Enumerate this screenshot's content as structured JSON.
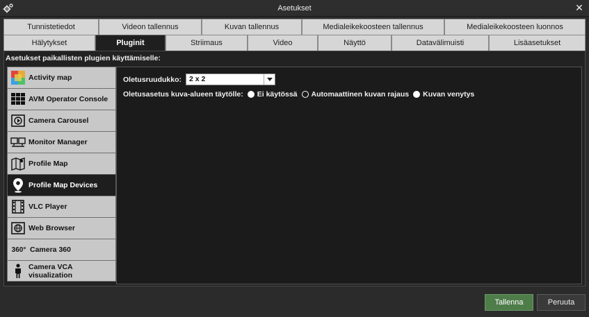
{
  "window": {
    "title": "Asetukset"
  },
  "tabs": {
    "row1": [
      {
        "label": "Tunnistetiedot"
      },
      {
        "label": "Videon tallennus"
      },
      {
        "label": "Kuvan tallennus"
      },
      {
        "label": "Medialeikekoosteen tallennus"
      },
      {
        "label": "Medialeikekoosteen luonnos"
      }
    ],
    "row2": [
      {
        "label": "Hälytykset"
      },
      {
        "label": "Pluginit",
        "active": true
      },
      {
        "label": "Striimaus"
      },
      {
        "label": "Video"
      },
      {
        "label": "Näyttö"
      },
      {
        "label": "Datavälimuisti"
      },
      {
        "label": "Lisäasetukset"
      }
    ]
  },
  "panel": {
    "caption": "Asetukset paikallisten plugien käyttämiselle:"
  },
  "plugins": [
    {
      "label": "Activity map",
      "icon": "activity-map-icon"
    },
    {
      "label": "AVM Operator Console",
      "icon": "video-wall-icon"
    },
    {
      "label": "Camera Carousel",
      "icon": "camera-carousel-icon"
    },
    {
      "label": "Monitor Manager",
      "icon": "monitor-icon"
    },
    {
      "label": "Profile Map",
      "icon": "map-icon"
    },
    {
      "label": "Profile Map Devices",
      "icon": "map-pin-icon",
      "active": true
    },
    {
      "label": "VLC Player",
      "icon": "film-icon"
    },
    {
      "label": "Web Browser",
      "icon": "globe-icon"
    },
    {
      "label": "Camera 360",
      "icon": "camera-360-icon",
      "icon_text": "360°"
    },
    {
      "label": "Camera VCA visualization",
      "icon": "person-icon"
    }
  ],
  "settings": {
    "grid_label": "Oletusruudukko:",
    "grid_value": "2 x 2",
    "fill_label": "Oletusasetus kuva-alueen täytölle:",
    "fill_options": [
      {
        "label": "Ei käytössä",
        "selected": true
      },
      {
        "label": "Automaattinen kuvan rajaus",
        "selected": false
      },
      {
        "label": "Kuvan venytys",
        "selected": true
      }
    ]
  },
  "buttons": {
    "save": "Tallenna",
    "cancel": "Peruuta"
  },
  "colors": {
    "save_button": "#4e7d4a",
    "active_tab": "#1f1f1f",
    "inactive_tab": "#d6d6d6"
  }
}
